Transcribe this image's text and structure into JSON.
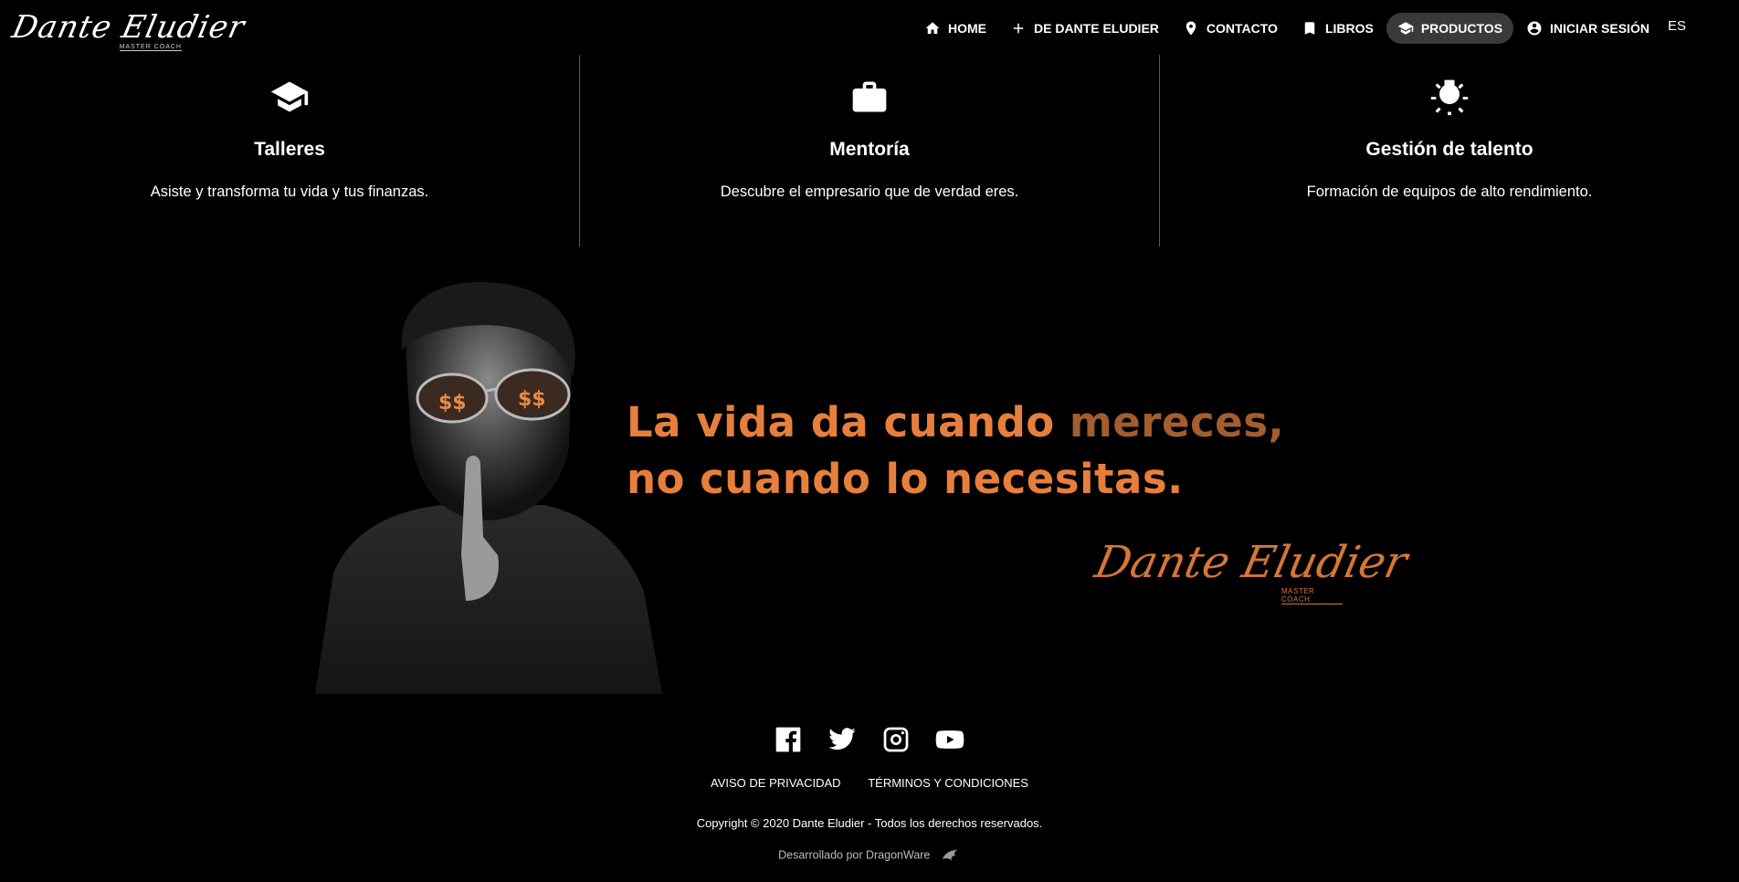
{
  "brand": {
    "logo_text": "Dante Eludier",
    "logo_tagline": "MASTER COACH"
  },
  "nav": {
    "items": [
      {
        "label": "HOME",
        "icon": "home-icon"
      },
      {
        "label": "DE DANTE ELUDIER",
        "icon": "plus-icon"
      },
      {
        "label": "CONTACTO",
        "icon": "location-pin-icon"
      },
      {
        "label": "LIBROS",
        "icon": "bookmark-icon"
      },
      {
        "label": "PRODUCTOS",
        "icon": "graduation-cap-icon",
        "active": true
      },
      {
        "label": "INICIAR SESIÓN",
        "icon": "account-circle-icon"
      }
    ],
    "language": "ES"
  },
  "features": [
    {
      "icon": "graduation-cap-icon",
      "title": "Talleres",
      "description": "Asiste y transforma tu vida y tus finanzas."
    },
    {
      "icon": "briefcase-icon",
      "title": "Mentoría",
      "description": "Descubre el empresario que de verdad eres."
    },
    {
      "icon": "lightbulb-icon",
      "title": "Gestión de talento",
      "description": "Formación de equipos de alto rendimiento."
    }
  ],
  "hero": {
    "quote_line1_a": "La vida da cuando ",
    "quote_line1_b": "mereces,",
    "quote_line2_a": "no cuando lo ",
    "quote_line2_b": "necesitas.",
    "signature": "Dante Eludier",
    "signature_tagline": "MASTER COACH",
    "accent_color": "#e77f3c"
  },
  "footer": {
    "social": [
      "facebook-icon",
      "twitter-icon",
      "instagram-icon",
      "youtube-icon"
    ],
    "links": [
      "AVISO DE PRIVACIDAD",
      "TÉRMINOS Y CONDICIONES"
    ],
    "copyright": "Copyright © 2020 Dante Eludier - Todos los derechos reservados.",
    "developed_by": "Desarrollado por DragonWare"
  }
}
